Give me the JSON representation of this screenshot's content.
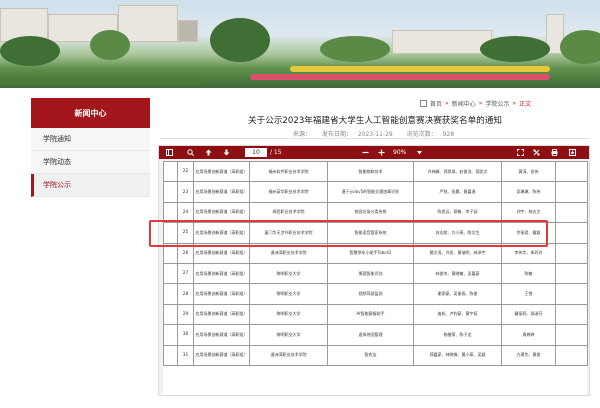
{
  "sidebar": {
    "header": "新闻中心",
    "items": [
      {
        "label": "学院通知",
        "active": false
      },
      {
        "label": "学院动态",
        "active": false
      },
      {
        "label": "学院公示",
        "active": true
      }
    ]
  },
  "breadcrumb": {
    "items": [
      "首页",
      "新闻中心",
      "学院公示",
      "正文"
    ],
    "separator": "»"
  },
  "article": {
    "title": "关于公示2023年福建省大学生人工智能创意赛决赛获奖名单的通知",
    "source_label": "来源：",
    "date_label": "发布日期：",
    "date": "2023-11-29",
    "views_label": "浏览次数：",
    "views": "928"
  },
  "viewer": {
    "current_page": "10",
    "total_pages": "/ 15",
    "zoom": "90%",
    "icons": [
      "sidebar-toggle-icon",
      "search-icon",
      "page-up-icon",
      "page-down-icon",
      "zoom-out-icon",
      "zoom-in-icon",
      "fullscreen-icon",
      "presentation-icon",
      "print-icon",
      "download-icon"
    ]
  },
  "table": {
    "rows": [
      {
        "no": "22",
        "cat": "应用场景创新赛道（高职组）",
        "school": "福州软件职业技术学院",
        "project": "智能物联技术",
        "members": "许林峰、郑思琪、赵俊浩、邱凯文",
        "advisor": "黄涛、张伟"
      },
      {
        "no": "23",
        "cat": "应用场景创新赛道（高职组）",
        "school": "福州英华职业技术学院",
        "project": "基于yolov5的智能交通违章识别",
        "members": "严铭、张晨、黄嘉逸",
        "advisor": "吴琳琳、陈伟"
      },
      {
        "no": "24",
        "cat": "应用场景创新赛道（高职组）",
        "school": "闽西职业技术学院",
        "project": "校园垃圾分类系统",
        "members": "陈思远、郭敏、李子涵",
        "advisor": "刘宇、林志文"
      },
      {
        "no": "25",
        "cat": "应用场景创新赛道（高职组）",
        "school": "厦门华天涉外职业技术学院",
        "project": "智能语音管家系统",
        "members": "苏志航、方小燕、陈文生",
        "advisor": "余丽君、戴颖"
      },
      {
        "no": "26",
        "cat": "应用场景创新赛道（高职组）",
        "school": "湄洲湾职业技术学院",
        "project": "智慧停车小助手Tabs42",
        "members": "黄文涛、许凯、黄瑞明、林泽宇",
        "advisor": "李伟华、朱玲玲"
      },
      {
        "no": "27",
        "cat": "应用场景创新赛道（高职组）",
        "school": "黎明职业大学",
        "project": "果蔬智能识别",
        "members": "林俊杰、黄晓敏、吴嘉豪",
        "advisor": "陈敏"
      },
      {
        "no": "28",
        "cat": "应用场景创新赛道（高职组）",
        "school": "黎明职业大学",
        "project": "视频驾驶监测",
        "members": "谢家豪、吴振扬、陈俊",
        "advisor": "王雪"
      },
      {
        "no": "29",
        "cat": "应用场景创新赛道（高职组）",
        "school": "黎明职业大学",
        "project": "AI智能客服助手",
        "members": "庞杭、卢钧豪、黄宇辰",
        "advisor": "戴丽莉、邱淑芬"
      },
      {
        "no": "30",
        "cat": "应用场景创新赛道（高职组）",
        "school": "黎明职业大学",
        "project": "虚拟茶园管理",
        "members": "杨楷荣、陈子龙",
        "advisor": "周婷婷"
      },
      {
        "no": "31",
        "cat": "应用场景创新赛道（高职组）",
        "school": "湄洲湾职业技术学院",
        "project": "智农宝",
        "members": "郑嘉豪、林晓梅、黄小燕、吴颖",
        "advisor": "方建华、黄俊"
      }
    ]
  }
}
